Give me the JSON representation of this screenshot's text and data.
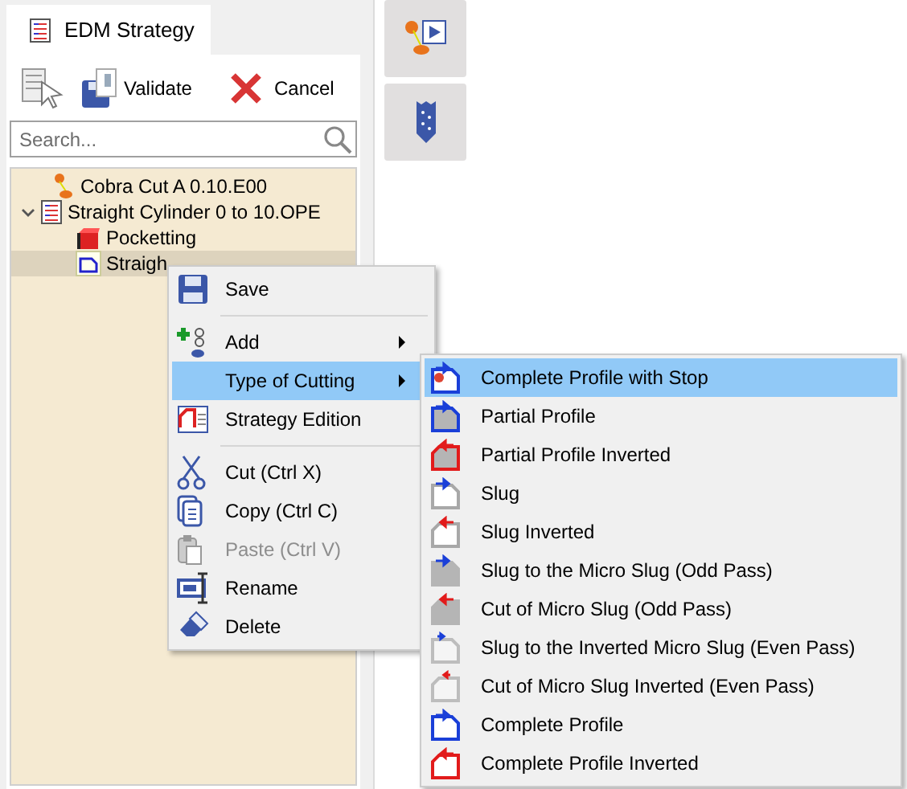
{
  "tab": {
    "label": "EDM Strategy",
    "selected": true
  },
  "toolbar": {
    "validate": "Validate",
    "cancel": "Cancel"
  },
  "search": {
    "placeholder": "Search..."
  },
  "tree": [
    {
      "label": "Cobra Cut A 0.10.E00",
      "selected": false
    },
    {
      "label": "Straight Cylinder 0 to 10.OPE",
      "selected": false,
      "expanded": true,
      "children": [
        {
          "label": "Pocketting",
          "selected": false
        },
        {
          "label": "Straigh",
          "selected": true
        }
      ]
    }
  ],
  "context_menu": [
    {
      "kind": "item",
      "label": "Save",
      "selected": false,
      "disabled": false,
      "submenu": false
    },
    {
      "kind": "separator"
    },
    {
      "kind": "item",
      "label": "Add",
      "selected": false,
      "disabled": false,
      "submenu": true
    },
    {
      "kind": "item",
      "label": "Type of Cutting",
      "selected": true,
      "disabled": false,
      "submenu": true
    },
    {
      "kind": "item",
      "label": "Strategy Edition",
      "selected": false,
      "disabled": false,
      "submenu": false
    },
    {
      "kind": "separator"
    },
    {
      "kind": "item",
      "label": "Cut (Ctrl X)",
      "selected": false,
      "disabled": false,
      "submenu": false
    },
    {
      "kind": "item",
      "label": "Copy (Ctrl C)",
      "selected": false,
      "disabled": false,
      "submenu": false
    },
    {
      "kind": "item",
      "label": "Paste (Ctrl V)",
      "selected": false,
      "disabled": true,
      "submenu": false
    },
    {
      "kind": "item",
      "label": "Rename",
      "selected": false,
      "disabled": false,
      "submenu": false
    },
    {
      "kind": "item",
      "label": "Delete",
      "selected": false,
      "disabled": false,
      "submenu": false
    }
  ],
  "submenu": [
    {
      "label": "Complete Profile with Stop",
      "selected": true
    },
    {
      "label": "Partial Profile",
      "selected": false
    },
    {
      "label": "Partial Profile Inverted",
      "selected": false
    },
    {
      "label": "Slug",
      "selected": false
    },
    {
      "label": "Slug Inverted",
      "selected": false
    },
    {
      "label": "Slug to the Micro Slug (Odd Pass)",
      "selected": false
    },
    {
      "label": "Cut of Micro Slug (Odd Pass)",
      "selected": false
    },
    {
      "label": "Slug to the Inverted Micro Slug (Even Pass)",
      "selected": false
    },
    {
      "label": "Cut of Micro Slug Inverted (Even Pass)",
      "selected": false
    },
    {
      "label": "Complete Profile",
      "selected": false
    },
    {
      "label": "Complete Profile Inverted",
      "selected": false
    }
  ]
}
